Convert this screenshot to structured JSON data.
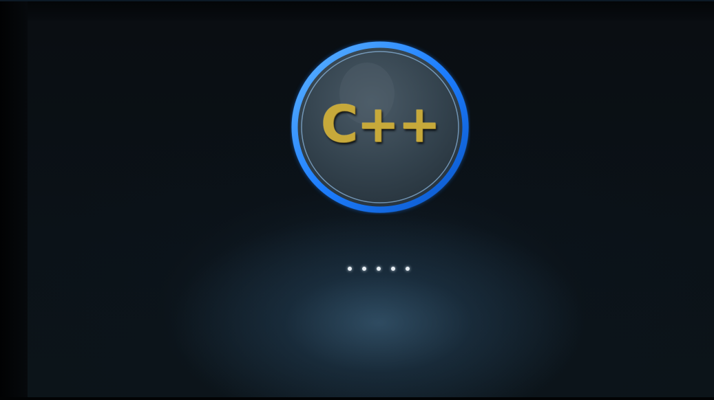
{
  "splash": {
    "logo_text": "C++",
    "loading_dots": 5
  },
  "colors": {
    "ring": "#1e88ff",
    "logo_fill": "#3b4a55",
    "logo_text": "#c7a93a",
    "background": "#0b1218"
  },
  "icons": [
    "cpp-logo-icon",
    "loading-indicator"
  ]
}
